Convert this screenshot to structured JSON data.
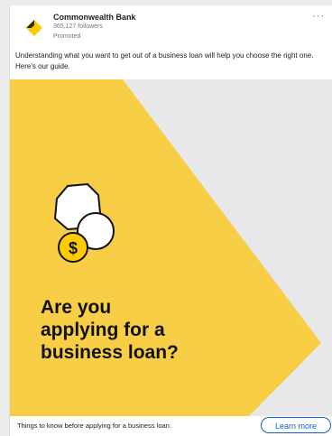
{
  "post": {
    "company_name": "Commonwealth Bank",
    "followers": "365,127 followers",
    "promoted": "Promoted",
    "more_label": "···",
    "text": "Understanding what you want to get out of a business loan will help you choose the right one. Here's our guide."
  },
  "ad": {
    "headline_line1": "Are you",
    "headline_line2": "applying for a",
    "headline_line3": "business loan?",
    "coin_symbol": "$",
    "coin_icon": "coins-icon"
  },
  "footer": {
    "caption": "Things to know before applying for a business loan.",
    "cta_label": "Learn more"
  },
  "colors": {
    "brand_yellow": "#FFCC00",
    "ad_yellow": "#F8CE47",
    "ad_background": "#E8E8EA",
    "link_blue": "#0A66C2",
    "text_dark": "#111111"
  }
}
